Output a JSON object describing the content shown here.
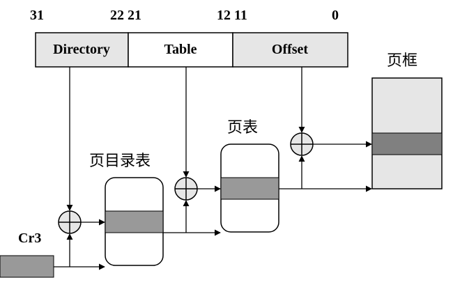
{
  "address_fields": {
    "bits": {
      "b31": "31",
      "b22_21": "22 21",
      "b12_11": "12 11",
      "b0": "0"
    },
    "directory_label": "Directory",
    "table_label": "Table",
    "offset_label": "Offset"
  },
  "labels": {
    "page_directory": "页目录表",
    "page_table": "页表",
    "page_frame": "页框",
    "cr3": "Cr3"
  },
  "colors": {
    "field_fill": "#e6e6e6",
    "entry_fill": "#999999",
    "frame_fill": "#e6e6e6",
    "frame_entry_fill": "#808080",
    "cr3_fill": "#999999",
    "line": "#000000"
  }
}
